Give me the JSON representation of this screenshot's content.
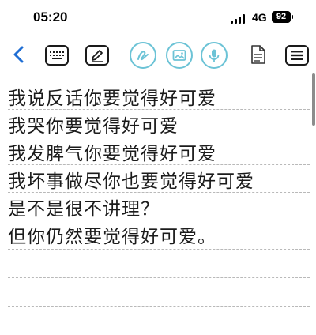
{
  "status": {
    "time": "05:20",
    "network": "4G",
    "battery": "92"
  },
  "colors": {
    "accent_blue": "#1f6ed4",
    "accent_teal": "#6cc3d6",
    "line": "#b9b9b9"
  },
  "toolbar": {
    "icons": [
      "back-icon",
      "keyboard-icon",
      "pen-icon",
      "handwriting-icon",
      "image-icon",
      "microphone-icon",
      "document-icon",
      "menu-icon"
    ]
  },
  "note": {
    "lines": [
      "我说反话你要觉得好可爱",
      "我哭你要觉得好可爱",
      "我发脾气你要觉得好可爱",
      "我坏事做尽你也要觉得好可爱",
      "是不是很不讲理？",
      "但你仍然要觉得好可爱。",
      "",
      "",
      ""
    ]
  }
}
